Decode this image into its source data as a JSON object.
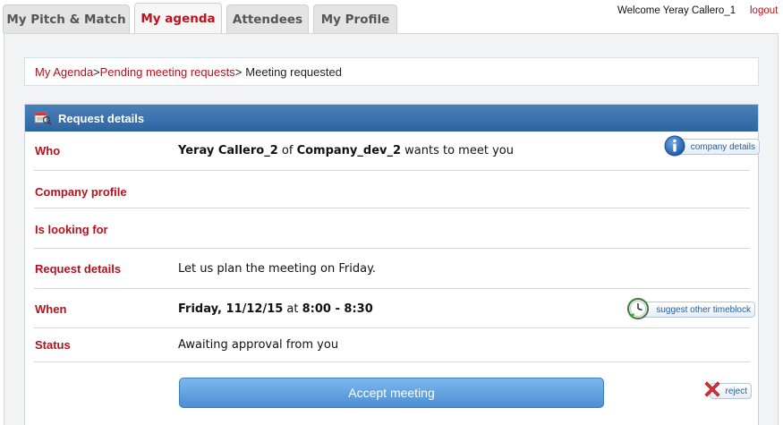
{
  "tabs": [
    {
      "label": "My Pitch & Match",
      "active": false
    },
    {
      "label": "My agenda",
      "active": true
    },
    {
      "label": "Attendees",
      "active": false
    },
    {
      "label": "My Profile",
      "active": false
    }
  ],
  "header": {
    "welcome": "Welcome Yeray Callero_1",
    "logout": "logout"
  },
  "breadcrumb": {
    "link1": "My Agenda",
    "sep1": ">",
    "link2": "Pending meeting requests",
    "sep2": ">",
    "current": "Meeting requested"
  },
  "details": {
    "title": "Request details",
    "who": {
      "label": "Who",
      "person": "Yeray Callero_2",
      "of": " of ",
      "company": "Company_dev_2",
      "suffix": " wants to meet you",
      "button": "company details"
    },
    "company_profile": {
      "label": "Company profile",
      "value": ""
    },
    "looking_for": {
      "label": "Is looking for",
      "value": ""
    },
    "request_details": {
      "label": "Request details",
      "value": "Let us plan the meeting on Friday."
    },
    "when": {
      "label": "When",
      "date": "Friday, 11/12/15",
      "at": " at ",
      "time": "8:00 - 8:30",
      "button": "suggest other timeblock"
    },
    "status": {
      "label": "Status",
      "value": "Awaiting approval from you"
    },
    "accept_button": "Accept meeting",
    "reject_button": "reject"
  },
  "colors": {
    "accent_red": "#b3121c",
    "header_blue": "#2e64a0",
    "button_blue": "#4a8fd3"
  },
  "icons": [
    "info-icon",
    "clock-icon",
    "reject-x-icon",
    "request-details-icon"
  ]
}
